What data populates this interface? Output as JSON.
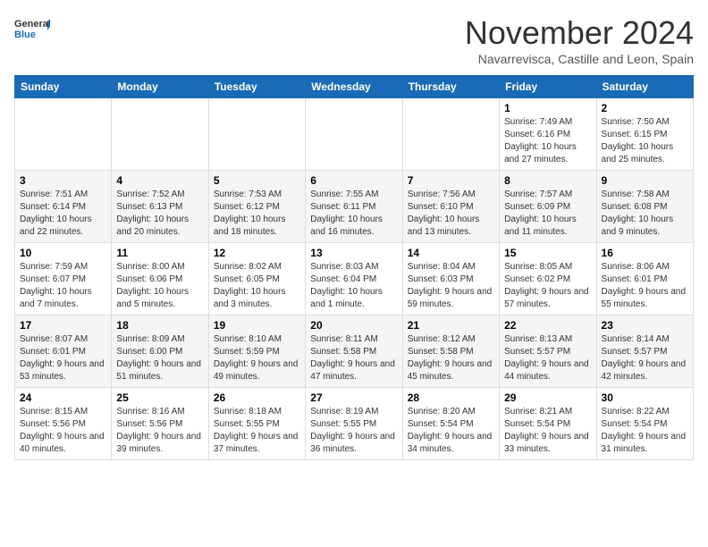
{
  "header": {
    "logo_general": "General",
    "logo_blue": "Blue",
    "month_title": "November 2024",
    "location": "Navarrevisca, Castille and Leon, Spain"
  },
  "weekdays": [
    "Sunday",
    "Monday",
    "Tuesday",
    "Wednesday",
    "Thursday",
    "Friday",
    "Saturday"
  ],
  "weeks": [
    [
      {
        "day": "",
        "info": ""
      },
      {
        "day": "",
        "info": ""
      },
      {
        "day": "",
        "info": ""
      },
      {
        "day": "",
        "info": ""
      },
      {
        "day": "",
        "info": ""
      },
      {
        "day": "1",
        "info": "Sunrise: 7:49 AM\nSunset: 6:16 PM\nDaylight: 10 hours and 27 minutes."
      },
      {
        "day": "2",
        "info": "Sunrise: 7:50 AM\nSunset: 6:15 PM\nDaylight: 10 hours and 25 minutes."
      }
    ],
    [
      {
        "day": "3",
        "info": "Sunrise: 7:51 AM\nSunset: 6:14 PM\nDaylight: 10 hours and 22 minutes."
      },
      {
        "day": "4",
        "info": "Sunrise: 7:52 AM\nSunset: 6:13 PM\nDaylight: 10 hours and 20 minutes."
      },
      {
        "day": "5",
        "info": "Sunrise: 7:53 AM\nSunset: 6:12 PM\nDaylight: 10 hours and 18 minutes."
      },
      {
        "day": "6",
        "info": "Sunrise: 7:55 AM\nSunset: 6:11 PM\nDaylight: 10 hours and 16 minutes."
      },
      {
        "day": "7",
        "info": "Sunrise: 7:56 AM\nSunset: 6:10 PM\nDaylight: 10 hours and 13 minutes."
      },
      {
        "day": "8",
        "info": "Sunrise: 7:57 AM\nSunset: 6:09 PM\nDaylight: 10 hours and 11 minutes."
      },
      {
        "day": "9",
        "info": "Sunrise: 7:58 AM\nSunset: 6:08 PM\nDaylight: 10 hours and 9 minutes."
      }
    ],
    [
      {
        "day": "10",
        "info": "Sunrise: 7:59 AM\nSunset: 6:07 PM\nDaylight: 10 hours and 7 minutes."
      },
      {
        "day": "11",
        "info": "Sunrise: 8:00 AM\nSunset: 6:06 PM\nDaylight: 10 hours and 5 minutes."
      },
      {
        "day": "12",
        "info": "Sunrise: 8:02 AM\nSunset: 6:05 PM\nDaylight: 10 hours and 3 minutes."
      },
      {
        "day": "13",
        "info": "Sunrise: 8:03 AM\nSunset: 6:04 PM\nDaylight: 10 hours and 1 minute."
      },
      {
        "day": "14",
        "info": "Sunrise: 8:04 AM\nSunset: 6:03 PM\nDaylight: 9 hours and 59 minutes."
      },
      {
        "day": "15",
        "info": "Sunrise: 8:05 AM\nSunset: 6:02 PM\nDaylight: 9 hours and 57 minutes."
      },
      {
        "day": "16",
        "info": "Sunrise: 8:06 AM\nSunset: 6:01 PM\nDaylight: 9 hours and 55 minutes."
      }
    ],
    [
      {
        "day": "17",
        "info": "Sunrise: 8:07 AM\nSunset: 6:01 PM\nDaylight: 9 hours and 53 minutes."
      },
      {
        "day": "18",
        "info": "Sunrise: 8:09 AM\nSunset: 6:00 PM\nDaylight: 9 hours and 51 minutes."
      },
      {
        "day": "19",
        "info": "Sunrise: 8:10 AM\nSunset: 5:59 PM\nDaylight: 9 hours and 49 minutes."
      },
      {
        "day": "20",
        "info": "Sunrise: 8:11 AM\nSunset: 5:58 PM\nDaylight: 9 hours and 47 minutes."
      },
      {
        "day": "21",
        "info": "Sunrise: 8:12 AM\nSunset: 5:58 PM\nDaylight: 9 hours and 45 minutes."
      },
      {
        "day": "22",
        "info": "Sunrise: 8:13 AM\nSunset: 5:57 PM\nDaylight: 9 hours and 44 minutes."
      },
      {
        "day": "23",
        "info": "Sunrise: 8:14 AM\nSunset: 5:57 PM\nDaylight: 9 hours and 42 minutes."
      }
    ],
    [
      {
        "day": "24",
        "info": "Sunrise: 8:15 AM\nSunset: 5:56 PM\nDaylight: 9 hours and 40 minutes."
      },
      {
        "day": "25",
        "info": "Sunrise: 8:16 AM\nSunset: 5:56 PM\nDaylight: 9 hours and 39 minutes."
      },
      {
        "day": "26",
        "info": "Sunrise: 8:18 AM\nSunset: 5:55 PM\nDaylight: 9 hours and 37 minutes."
      },
      {
        "day": "27",
        "info": "Sunrise: 8:19 AM\nSunset: 5:55 PM\nDaylight: 9 hours and 36 minutes."
      },
      {
        "day": "28",
        "info": "Sunrise: 8:20 AM\nSunset: 5:54 PM\nDaylight: 9 hours and 34 minutes."
      },
      {
        "day": "29",
        "info": "Sunrise: 8:21 AM\nSunset: 5:54 PM\nDaylight: 9 hours and 33 minutes."
      },
      {
        "day": "30",
        "info": "Sunrise: 8:22 AM\nSunset: 5:54 PM\nDaylight: 9 hours and 31 minutes."
      }
    ]
  ]
}
